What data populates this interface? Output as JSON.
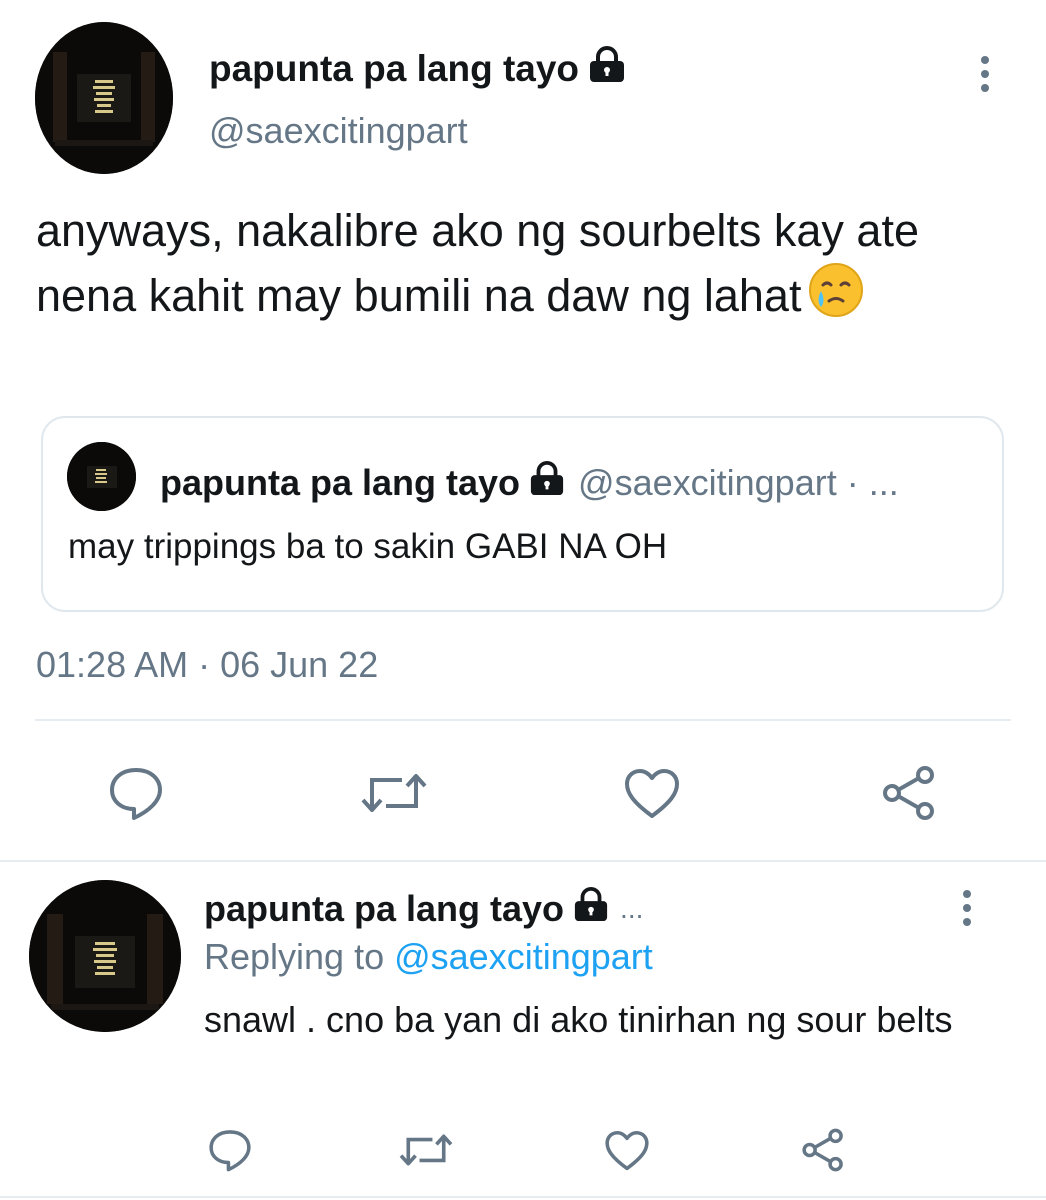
{
  "main_tweet": {
    "display_name": "papunta pa lang tayo",
    "handle": "@saexcitingpart",
    "text": "anyways, nakalibre ako ng sourbelts kay ate nena kahit may bumili na daw ng lahat",
    "emoji": "face-holding-back-tears",
    "timestamp": "01:28 AM · 06 Jun 22"
  },
  "quoted_tweet": {
    "display_name": "papunta pa lang tayo",
    "handle": "@saexcitingpart · ...",
    "text": "may trippings ba to sakin GABI NA OH"
  },
  "actions": [
    "reply-icon",
    "retweet-icon",
    "like-icon",
    "share-icon"
  ],
  "reply_tweet": {
    "display_name": "papunta pa lang tayo",
    "name_overflow": "...",
    "replying_prefix": "Replying to",
    "replying_handle": "@saexcitingpart",
    "text": "snawl . cno ba yan di ako tinirhan ng sour belts"
  },
  "colors": {
    "text": "#14171a",
    "secondary": "#657786",
    "link": "#1da1f2",
    "border": "#e1e8ed"
  }
}
